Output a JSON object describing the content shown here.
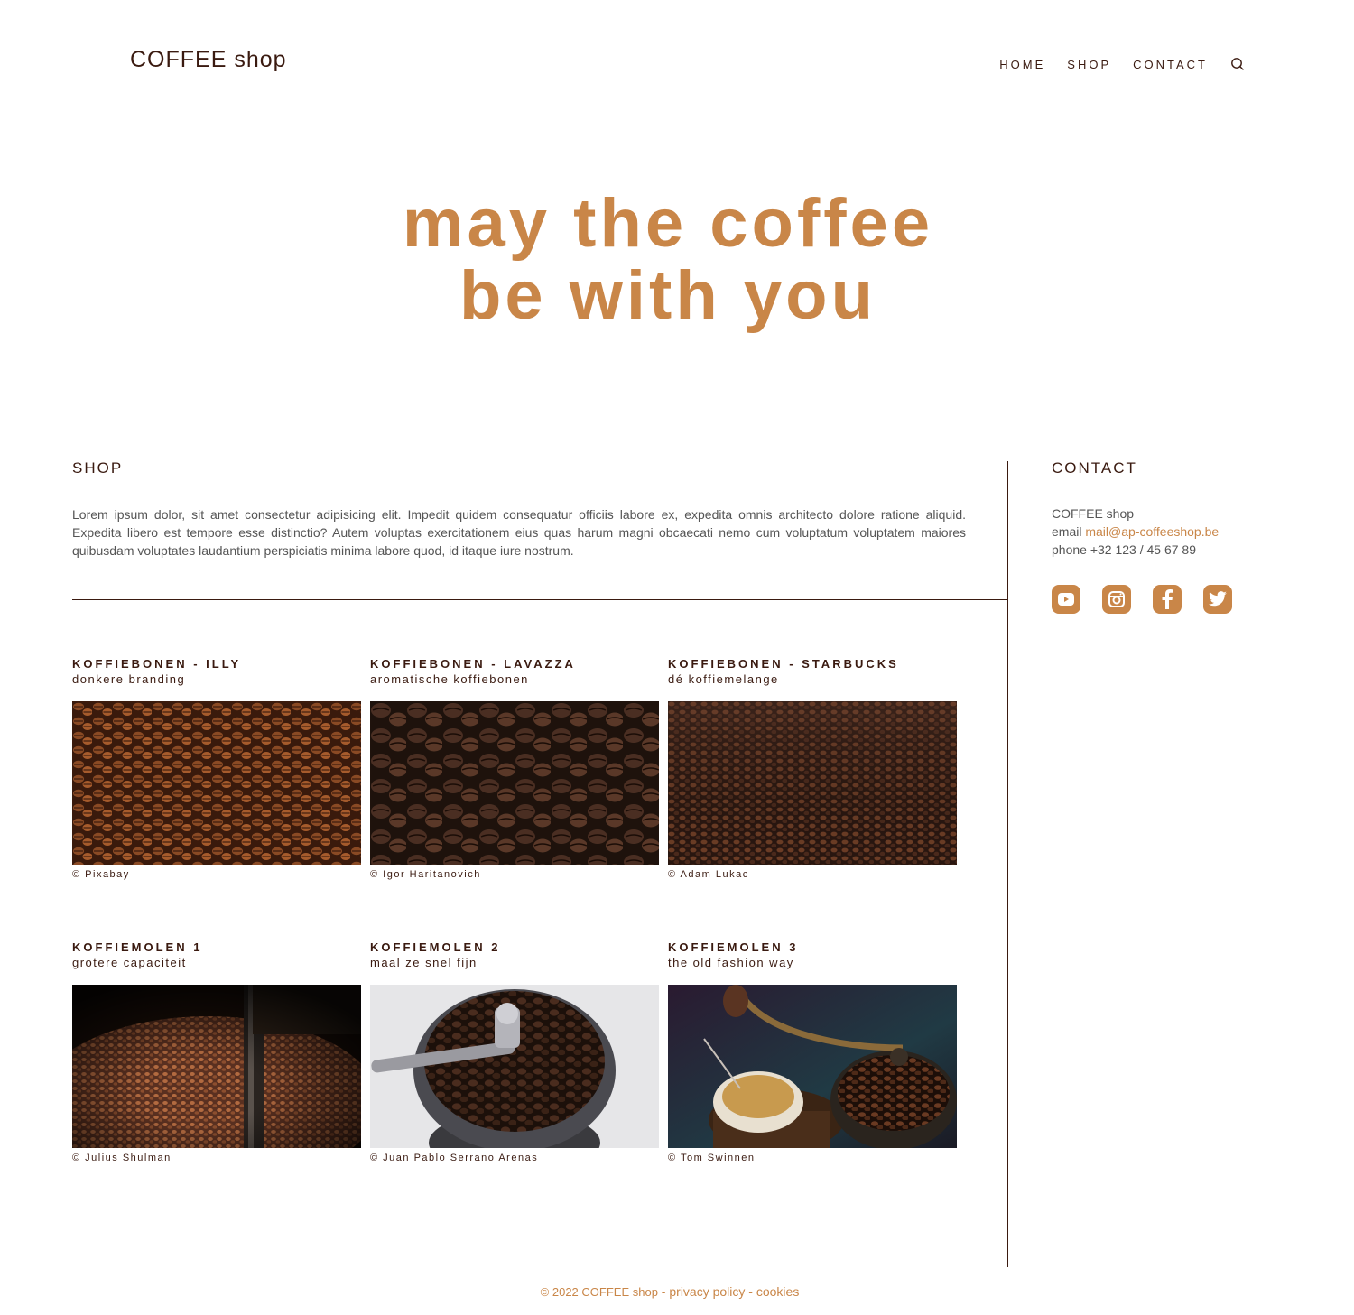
{
  "header": {
    "logo": "COFFEE shop",
    "nav": [
      "HOME",
      "SHOP",
      "CONTACT"
    ]
  },
  "hero": {
    "line1": "may the coffee",
    "line2": "be with you"
  },
  "shop": {
    "title": "SHOP",
    "text": "Lorem ipsum dolor, sit amet consectetur adipisicing elit. Impedit quidem consequatur officiis labore ex, expedita omnis architecto dolore ratione aliquid. Expedita libero est tempore esse distinctio? Autem voluptas exercitationem eius quas harum magni obcaecati nemo cum voluptatum voluptatem maiores quibusdam voluptates laudantium perspiciatis minima labore quod, id itaque iure nostrum.",
    "products": [
      {
        "title": "KOFFIEBONEN - ILLY",
        "subtitle": "donkere branding",
        "credit": "© Pixabay"
      },
      {
        "title": "KOFFIEBONEN - LAVAZZA",
        "subtitle": "aromatische koffiebonen",
        "credit": "© Igor Haritanovich"
      },
      {
        "title": "KOFFIEBONEN - STARBUCKS",
        "subtitle": "dé koffiemelange",
        "credit": "© Adam Lukac"
      },
      {
        "title": "KOFFIEMOLEN 1",
        "subtitle": "grotere capaciteit",
        "credit": "© Julius Shulman"
      },
      {
        "title": "KOFFIEMOLEN 2",
        "subtitle": "maal ze snel fijn",
        "credit": "© Juan Pablo Serrano Arenas"
      },
      {
        "title": "KOFFIEMOLEN 3",
        "subtitle": "the old fashion way",
        "credit": "© Tom Swinnen"
      }
    ]
  },
  "contact": {
    "title": "CONTACT",
    "name": "COFFEE shop",
    "email_label": "email",
    "email": "mail@ap-coffeeshop.be",
    "phone_label": "phone",
    "phone": "+32 123 / 45 67 89",
    "socials": [
      "youtube-icon",
      "instagram-icon",
      "facebook-icon",
      "twitter-icon"
    ]
  },
  "footer": {
    "copyright": "© 2022 COFFEE shop",
    "sep": " - ",
    "privacy": "privacy policy",
    "cookies": "cookies"
  },
  "colors": {
    "accent": "#c98648",
    "text_dark": "#3a1a10",
    "text_body": "#555555"
  }
}
